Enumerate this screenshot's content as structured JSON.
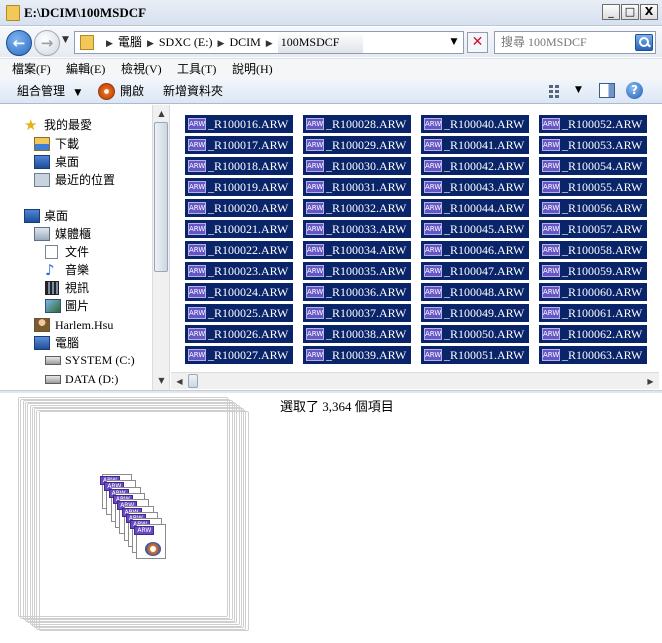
{
  "window": {
    "title": "E:\\DCIM\\100MSDCF",
    "minimize": "_",
    "maximize": "□",
    "close": "X"
  },
  "address": {
    "crumbs": [
      "電腦",
      "SDXC (E:)",
      "DCIM",
      "100MSDCF"
    ],
    "search_placeholder": "搜尋 100MSDCF"
  },
  "menu": [
    "檔案(F)",
    "編輯(E)",
    "檢視(V)",
    "工具(T)",
    "說明(H)"
  ],
  "toolbar": {
    "organize": "組合管理",
    "open": "開啟",
    "new_folder": "新增資料夾"
  },
  "nav": [
    {
      "label": "我的最愛",
      "icon": "star-icon"
    },
    {
      "label": "下載",
      "icon": "download-folder-icon"
    },
    {
      "label": "桌面",
      "icon": "desktop-icon"
    },
    {
      "label": "最近的位置",
      "icon": "recent-places-icon"
    },
    {
      "label": "桌面",
      "icon": "desktop-icon"
    },
    {
      "label": "媒體櫃",
      "icon": "library-icon"
    },
    {
      "label": "文件",
      "icon": "documents-icon"
    },
    {
      "label": "音樂",
      "icon": "music-icon"
    },
    {
      "label": "視訊",
      "icon": "video-icon"
    },
    {
      "label": "圖片",
      "icon": "pictures-icon"
    },
    {
      "label": "Harlem.Hsu",
      "icon": "user-folder-icon"
    },
    {
      "label": "電腦",
      "icon": "computer-icon"
    },
    {
      "label": "SYSTEM (C:)",
      "icon": "drive-icon"
    },
    {
      "label": "DATA (D:)",
      "icon": "drive-icon"
    }
  ],
  "files": {
    "badge": "ARW",
    "columns": [
      [
        "_R100016.ARW",
        "_R100017.ARW",
        "_R100018.ARW",
        "_R100019.ARW",
        "_R100020.ARW",
        "_R100021.ARW",
        "_R100022.ARW",
        "_R100023.ARW",
        "_R100024.ARW",
        "_R100025.ARW",
        "_R100026.ARW",
        "_R100027.ARW"
      ],
      [
        "_R100028.ARW",
        "_R100029.ARW",
        "_R100030.ARW",
        "_R100031.ARW",
        "_R100032.ARW",
        "_R100033.ARW",
        "_R100034.ARW",
        "_R100035.ARW",
        "_R100036.ARW",
        "_R100037.ARW",
        "_R100038.ARW",
        "_R100039.ARW"
      ],
      [
        "_R100040.ARW",
        "_R100041.ARW",
        "_R100042.ARW",
        "_R100043.ARW",
        "_R100044.ARW",
        "_R100045.ARW",
        "_R100046.ARW",
        "_R100047.ARW",
        "_R100048.ARW",
        "_R100049.ARW",
        "_R100050.ARW",
        "_R100051.ARW"
      ],
      [
        "_R100052.ARW",
        "_R100053.ARW",
        "_R100054.ARW",
        "_R100055.ARW",
        "_R100056.ARW",
        "_R100057.ARW",
        "_R100058.ARW",
        "_R100059.ARW",
        "_R100060.ARW",
        "_R100061.ARW",
        "_R100062.ARW",
        "_R100063.ARW"
      ]
    ]
  },
  "details": {
    "selection_text": "選取了 3,364 個項目"
  },
  "colors": {
    "selection": "#0a246a",
    "arw_badge": "#6456c4"
  }
}
